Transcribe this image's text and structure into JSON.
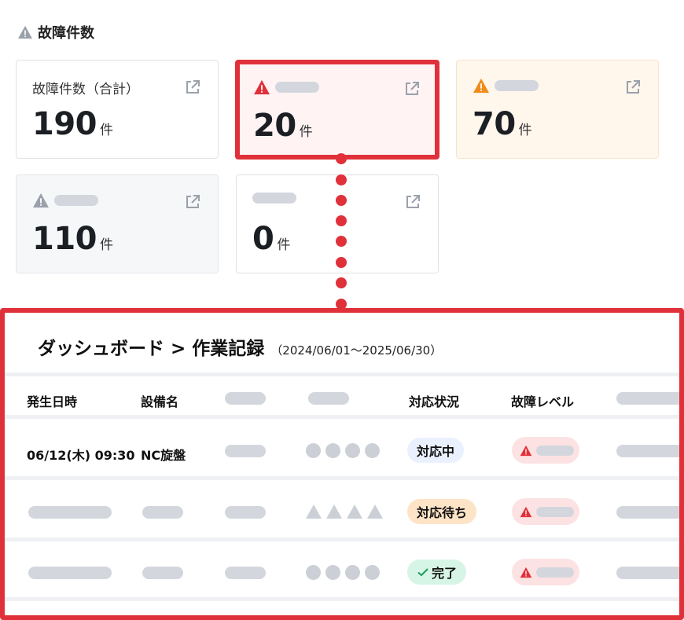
{
  "section": {
    "title": "故障件数",
    "icon": "warning-icon"
  },
  "cards": [
    {
      "label": "故障件数（合計）",
      "value": "190",
      "unit": "件",
      "icon": "external-link-icon"
    },
    {
      "label": "",
      "value": "20",
      "unit": "件",
      "icon": "warning-icon",
      "accent": "#e0313a"
    },
    {
      "label": "",
      "value": "70",
      "unit": "件",
      "icon": "warning-icon",
      "accent": "#f08c1a"
    },
    {
      "label": "",
      "value": "110",
      "unit": "件",
      "icon": "warning-icon",
      "accent": "#9aa1aa"
    },
    {
      "label": "",
      "value": "0",
      "unit": "件"
    }
  ],
  "panel": {
    "breadcrumb": "ダッシュボード > 作業記録",
    "date_range": "（2024/06/01～2025/06/30）",
    "columns": [
      "発生日時",
      "設備名",
      "",
      "",
      "対応状況",
      "故障レベル",
      ""
    ],
    "rows": [
      {
        "datetime": "06/12(木) 09:30",
        "equipment": "NC旋盤",
        "status": "対応中",
        "level_icon": "warning-icon"
      },
      {
        "datetime": "",
        "equipment": "",
        "status": "対応待ち",
        "level_icon": "warning-icon"
      },
      {
        "datetime": "",
        "equipment": "",
        "status": "完了",
        "status_icon": "check-icon",
        "level_icon": "warning-icon"
      }
    ]
  },
  "colors": {
    "highlight": "#e0313a",
    "warning_red": "#e0313a",
    "warning_orange": "#f08c1a",
    "warning_gray": "#9aa1aa"
  }
}
